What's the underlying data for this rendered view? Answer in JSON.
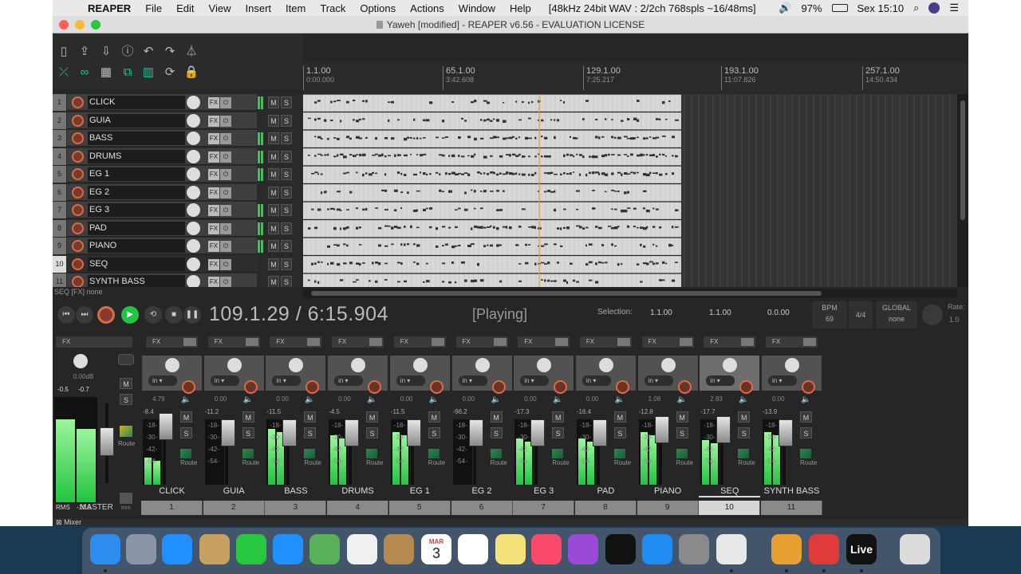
{
  "menubar": {
    "app": "REAPER",
    "items": [
      "File",
      "Edit",
      "View",
      "Insert",
      "Item",
      "Track",
      "Options",
      "Actions",
      "Window",
      "Help"
    ],
    "audio_info": "[48kHz 24bit WAV : 2/2ch 768spls ~16/48ms]",
    "battery": "97%",
    "clock": "Sex 15:10"
  },
  "window": {
    "title": "Yaweh [modified] - REAPER v6.56 - EVALUATION LICENSE"
  },
  "ruler": {
    "marks": [
      {
        "bar": "1.1.00",
        "time": "0:00.000"
      },
      {
        "bar": "65.1.00",
        "time": "3:42.608"
      },
      {
        "bar": "129.1.00",
        "time": "7:25.217"
      },
      {
        "bar": "193.1.00",
        "time": "11:07.826"
      },
      {
        "bar": "257.1.00",
        "time": "14:50.434"
      }
    ]
  },
  "tracks": [
    {
      "num": "1",
      "name": "CLICK"
    },
    {
      "num": "2",
      "name": "GUIA"
    },
    {
      "num": "3",
      "name": "BASS"
    },
    {
      "num": "4",
      "name": "DRUMS"
    },
    {
      "num": "5",
      "name": "EG 1"
    },
    {
      "num": "6",
      "name": "EG 2"
    },
    {
      "num": "7",
      "name": "EG 3"
    },
    {
      "num": "8",
      "name": "PAD"
    },
    {
      "num": "9",
      "name": "PIANO"
    },
    {
      "num": "10",
      "name": "SEQ"
    },
    {
      "num": "11",
      "name": "SYNTH BASS"
    }
  ],
  "track_labels": {
    "fx": "FX",
    "mute": "M",
    "solo": "S"
  },
  "status_line": "SEQ [FX] none",
  "transport": {
    "position": "109.1.29 / 6:15.904",
    "state": "[Playing]",
    "selection_label": "Selection:",
    "sel_start": "1.1.00",
    "sel_end": "1.1.00",
    "sel_len": "0.0.00",
    "bpm_label": "BPM",
    "bpm": "69",
    "time_sig": "4/4",
    "global_label": "GLOBAL",
    "global_value": "none",
    "rate_label": "Rate:",
    "rate": "1.0"
  },
  "master": {
    "fx": "FX",
    "vol": "0.00dB",
    "peak_l": "-0.5",
    "peak_r": "-0.7",
    "rms_label": "RMS",
    "rms": "-10.5",
    "label": "MASTER",
    "route": "Route",
    "trim": "trim"
  },
  "mixer_strips": [
    {
      "name": "CLICK",
      "num": "1",
      "vol": "4.79",
      "peak": "-8.4"
    },
    {
      "name": "GUIA",
      "num": "2",
      "vol": "0.00",
      "peak": "-11.2"
    },
    {
      "name": "BASS",
      "num": "3",
      "vol": "0.00",
      "peak": "-11.5"
    },
    {
      "name": "DRUMS",
      "num": "4",
      "vol": "0.00",
      "peak": "-4.5"
    },
    {
      "name": "EG 1",
      "num": "5",
      "vol": "0.00",
      "peak": "-11.5"
    },
    {
      "name": "EG 2",
      "num": "6",
      "vol": "0.00",
      "peak": "-96.2"
    },
    {
      "name": "EG 3",
      "num": "7",
      "vol": "0.00",
      "peak": "-17.3"
    },
    {
      "name": "PAD",
      "num": "8",
      "vol": "0.00",
      "peak": "-16.4"
    },
    {
      "name": "PIANO",
      "num": "9",
      "vol": "1.08",
      "peak": "-12.8"
    },
    {
      "name": "SEQ",
      "num": "10",
      "vol": "2.83",
      "peak": "-17.7"
    },
    {
      "name": "SYNTH BASS",
      "num": "11",
      "vol": "0.00",
      "peak": "-13.9"
    }
  ],
  "strip_labels": {
    "fx": "FX",
    "in": "in",
    "route": "Route",
    "mute": "M",
    "solo": "S"
  },
  "mixer_tab": "Mixer",
  "dock_apps": [
    "Finder",
    "Launchpad",
    "Safari",
    "Preview",
    "FaceTime",
    "Messages",
    "Maps",
    "Photos",
    "Contacts",
    "Calendar",
    "Reminders",
    "Notes",
    "Music",
    "Podcasts",
    "TV",
    "App Store",
    "System Preferences",
    "Chrome",
    "Piano",
    "Vivaldi",
    "Live",
    "Trash"
  ],
  "dock_calendar": {
    "month": "MAR",
    "day": "3"
  },
  "colors": {
    "accent_green": "#22c442",
    "record": "#d96b49",
    "teal": "#1ec49b"
  }
}
